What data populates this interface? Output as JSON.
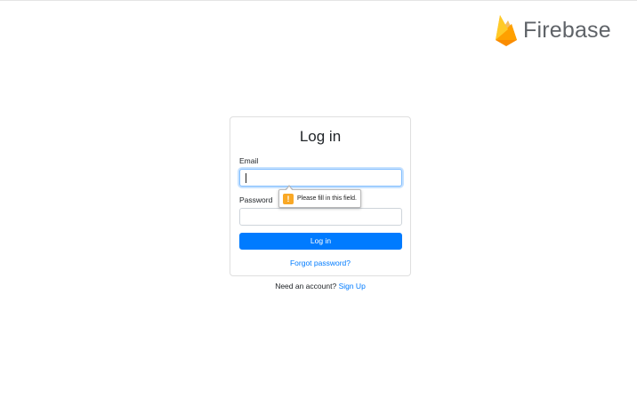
{
  "brand": {
    "logo_icon": "firebase-flame-icon",
    "name": "Firebase",
    "colors": {
      "flame_dark": "#FFA000",
      "flame_mid": "#F57C00",
      "flame_light": "#FFCA28",
      "text": "#5F6368"
    }
  },
  "login": {
    "title": "Log in",
    "email_label": "Email",
    "email_value": "",
    "password_label": "Password",
    "password_value": "",
    "submit_label": "Log in",
    "forgot_link": "Forgot password?"
  },
  "signup": {
    "prompt": "Need an account?",
    "link": "Sign Up"
  },
  "validation": {
    "icon": "warning-icon",
    "message": "Please fill in this field."
  },
  "colors": {
    "primary": "#007BFF",
    "warning": "#F9A825"
  }
}
